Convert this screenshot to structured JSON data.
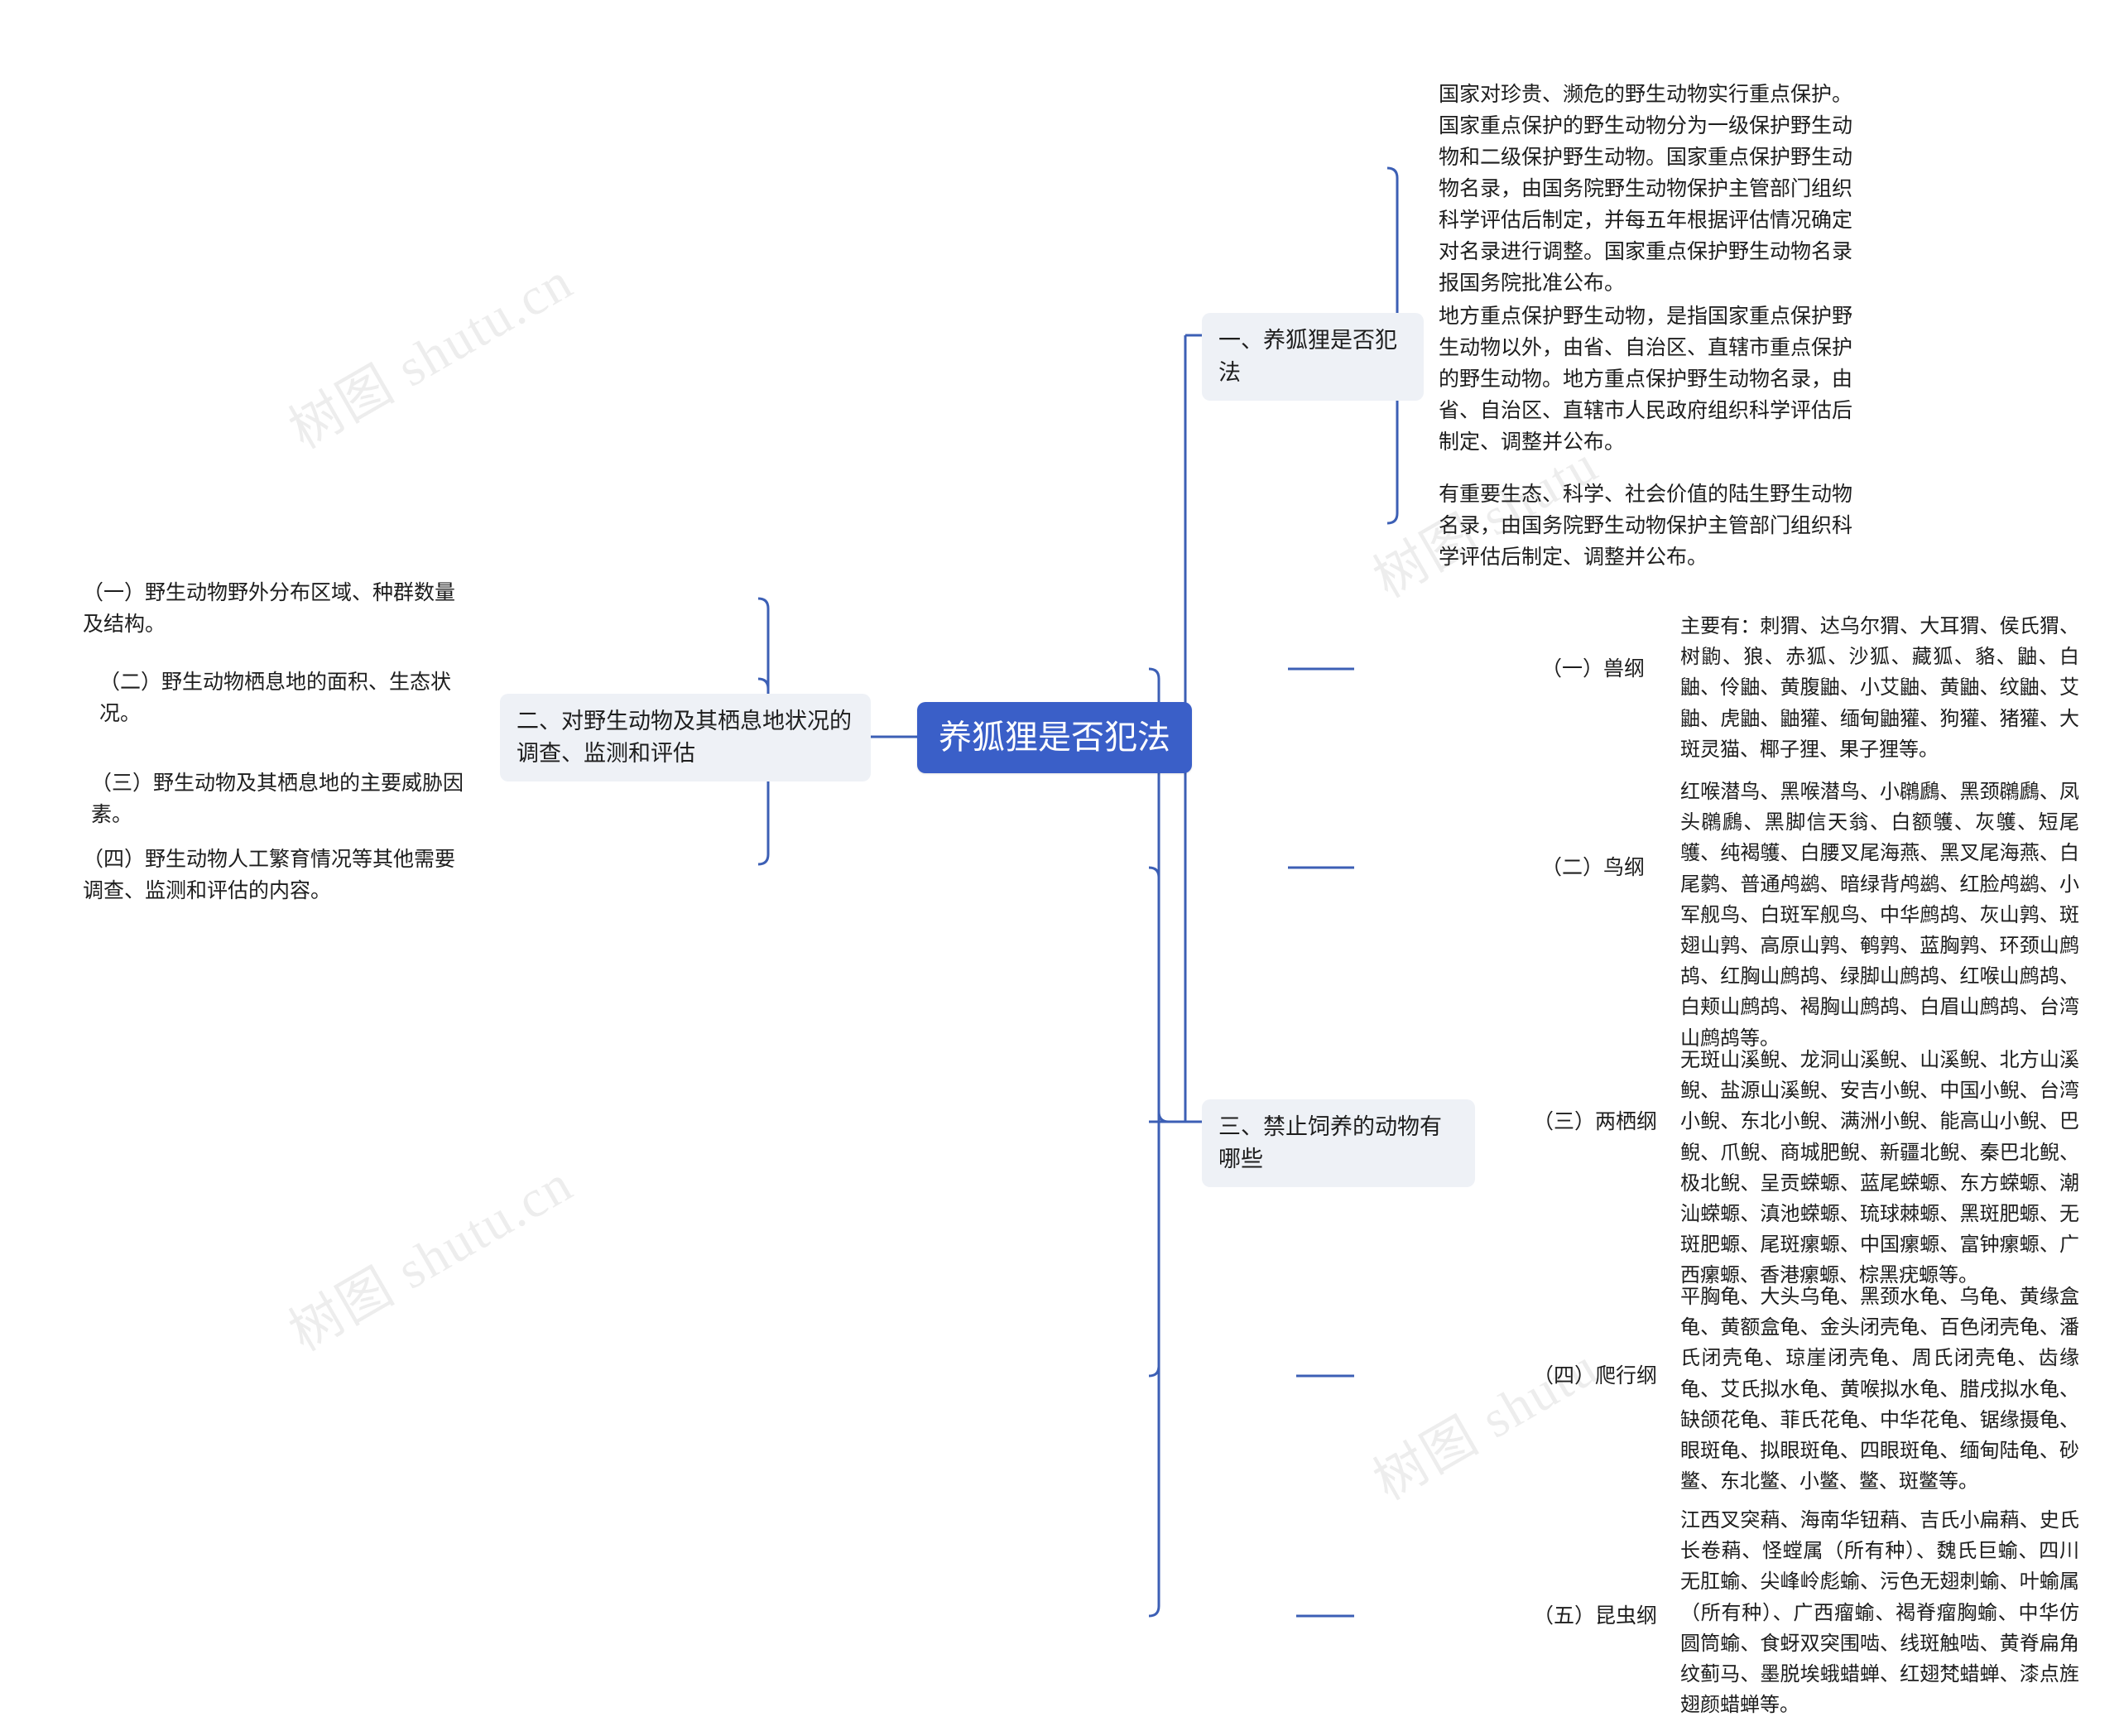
{
  "root": {
    "title": "养狐狸是否犯法",
    "accent_color": "#3a5fc8",
    "node_bg": "#eef1f6",
    "line_color": "#3c5fb5"
  },
  "watermark": {
    "text_cn": "树图 shutu.cn",
    "text_alt": "树图 shutu"
  },
  "branch_one": {
    "label": "一、养狐狸是否犯法",
    "items": [
      {
        "text": "国家对珍贵、濒危的野生动物实行重点保护。国家重点保护的野生动物分为一级保护野生动物和二级保护野生动物。国家重点保护野生动物名录，由国务院野生动物保护主管部门组织科学评估后制定，并每五年根据评估情况确定对名录进行调整。国家重点保护野生动物名录报国务院批准公布。"
      },
      {
        "text": "地方重点保护野生动物，是指国家重点保护野生动物以外，由省、自治区、直辖市重点保护的野生动物。地方重点保护野生动物名录，由省、自治区、直辖市人民政府组织科学评估后制定、调整并公布。"
      },
      {
        "text": "有重要生态、科学、社会价值的陆生野生动物名录，由国务院野生动物保护主管部门组织科学评估后制定、调整并公布。"
      }
    ]
  },
  "branch_two": {
    "label": "二、对野生动物及其栖息地状况的调查、监测和评估",
    "items": [
      {
        "text": "（一）野生动物野外分布区域、种群数量及结构。"
      },
      {
        "text": "（二）野生动物栖息地的面积、生态状况。"
      },
      {
        "text": "（三）野生动物及其栖息地的主要威胁因素。"
      },
      {
        "text": "（四）野生动物人工繁育情况等其他需要调查、监测和评估的内容。"
      }
    ]
  },
  "branch_three": {
    "label": "三、禁止饲养的动物有哪些",
    "classes": [
      {
        "label": "（一）兽纲",
        "text": "主要有：刺猬、达乌尔猬、大耳猬、侯氏猬、树鼩、狼、赤狐、沙狐、藏狐、貉、鼬、白鼬、伶鼬、黄腹鼬、小艾鼬、黄鼬、纹鼬、艾鼬、虎鼬、鼬獾、缅甸鼬獾、狗獾、猪獾、大斑灵猫、椰子狸、果子狸等。"
      },
      {
        "label": "（二）鸟纲",
        "text": "红喉潜鸟、黑喉潜鸟、小鸊鷉、黑颈鸊鷉、凤头鸊鷉、黑脚信天翁、白额鹱、灰鹱、短尾鹱、纯褐鹱、白腰叉尾海燕、黑叉尾海燕、白尾鹲、普通鸬鹚、暗绿背鸬鹚、红脸鸬鹚、小军舰鸟、白斑军舰鸟、中华鹧鸪、灰山鹑、斑翅山鹑、高原山鹑、鹌鹑、蓝胸鹑、环颈山鹧鸪、红胸山鹧鸪、绿脚山鹧鸪、红喉山鹧鸪、白颊山鹧鸪、褐胸山鹧鸪、白眉山鹧鸪、台湾山鹧鸪等。"
      },
      {
        "label": "（三）两栖纲",
        "text": "无斑山溪鲵、龙洞山溪鲵、山溪鲵、北方山溪鲵、盐源山溪鲵、安吉小鲵、中国小鲵、台湾小鲵、东北小鲵、满洲小鲵、能高山小鲵、巴鲵、爪鲵、商城肥鲵、新疆北鲵、秦巴北鲵、极北鲵、呈贡蝾螈、蓝尾蝾螈、东方蝾螈、潮汕蝾螈、滇池蝾螈、琉球棘螈、黑斑肥螈、无斑肥螈、尾斑瘰螈、中国瘰螈、富钟瘰螈、广西瘰螈、香港瘰螈、棕黑疣螈等。"
      },
      {
        "label": "（四）爬行纲",
        "text": "平胸龟、大头乌龟、黑颈水龟、乌龟、黄缘盒龟、黄额盒龟、金头闭壳龟、百色闭壳龟、潘氏闭壳龟、琼崖闭壳龟、周氏闭壳龟、齿缘龟、艾氏拟水龟、黄喉拟水龟、腊戌拟水龟、缺颌花龟、菲氏花龟、中华花龟、锯缘摄龟、眼斑龟、拟眼斑龟、四眼斑龟、缅甸陆龟、砂鳖、东北鳖、小鳖、鳖、斑鳖等。"
      },
      {
        "label": "（五）昆虫纲",
        "text": "江西叉突蕱、海南华钮蕱、吉氏小扁蕱、史氏长卷蕱、怪螳属（所有种）、魏氏巨蝓、四川无肛蝓、尖峰岭彪蝓、污色无翅刺蝓、叶蝓属（所有种）、广西瘤蝓、褐脊瘤胸蝓、中华仿圆筒蝓、食蚜双突围啮、线斑触啮、黄脊扁角纹蓟马、墨脱埃蛾蜡蝉、红翅梵蜡蝉、漆点旌翅颜蜡蝉等。"
      }
    ]
  }
}
